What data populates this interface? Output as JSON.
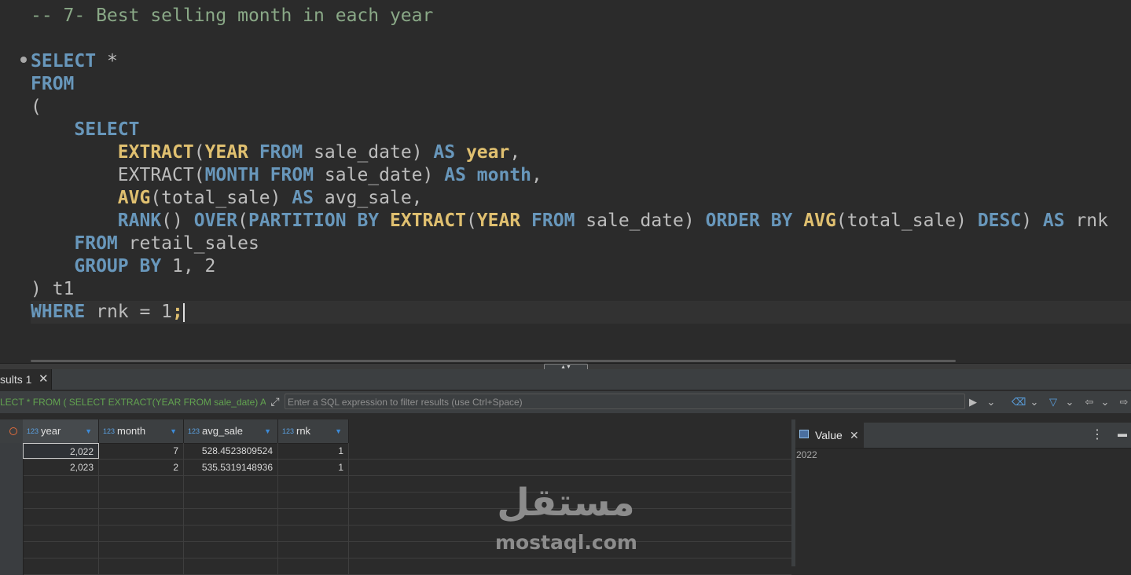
{
  "editor": {
    "lines": [
      [
        {
          "t": "-- 7- Best selling month in each year",
          "c": "cm"
        }
      ],
      [],
      [
        {
          "t": "SELECT",
          "c": "kw"
        },
        {
          "t": " *",
          "c": "plain"
        }
      ],
      [
        {
          "t": "FROM",
          "c": "kw"
        }
      ],
      [
        {
          "t": "(",
          "c": "plain"
        }
      ],
      [
        {
          "t": "    ",
          "c": "plain"
        },
        {
          "t": "SELECT",
          "c": "kw"
        }
      ],
      [
        {
          "t": "        ",
          "c": "plain"
        },
        {
          "t": "EXTRACT",
          "c": "fn"
        },
        {
          "t": "(",
          "c": "plain"
        },
        {
          "t": "YEAR",
          "c": "fn"
        },
        {
          "t": " ",
          "c": "plain"
        },
        {
          "t": "FROM",
          "c": "kw"
        },
        {
          "t": " sale_date) ",
          "c": "plain"
        },
        {
          "t": "AS",
          "c": "kw"
        },
        {
          "t": " ",
          "c": "plain"
        },
        {
          "t": "year",
          "c": "al"
        },
        {
          "t": ",",
          "c": "plain"
        }
      ],
      [
        {
          "t": "        EXTRACT(",
          "c": "plain"
        },
        {
          "t": "MONTH",
          "c": "kw"
        },
        {
          "t": " ",
          "c": "plain"
        },
        {
          "t": "FROM",
          "c": "kw"
        },
        {
          "t": " sale_date) ",
          "c": "plain"
        },
        {
          "t": "AS",
          "c": "kw"
        },
        {
          "t": " ",
          "c": "plain"
        },
        {
          "t": "month",
          "c": "kw"
        },
        {
          "t": ",",
          "c": "plain"
        }
      ],
      [
        {
          "t": "        ",
          "c": "plain"
        },
        {
          "t": "AVG",
          "c": "fn"
        },
        {
          "t": "(total_sale) ",
          "c": "plain"
        },
        {
          "t": "AS",
          "c": "kw"
        },
        {
          "t": " avg_sale,",
          "c": "plain"
        }
      ],
      [
        {
          "t": "        ",
          "c": "plain"
        },
        {
          "t": "RANK",
          "c": "kw"
        },
        {
          "t": "() ",
          "c": "plain"
        },
        {
          "t": "OVER",
          "c": "kw"
        },
        {
          "t": "(",
          "c": "plain"
        },
        {
          "t": "PARTITION BY",
          "c": "kw"
        },
        {
          "t": " ",
          "c": "plain"
        },
        {
          "t": "EXTRACT",
          "c": "fn"
        },
        {
          "t": "(",
          "c": "plain"
        },
        {
          "t": "YEAR",
          "c": "fn"
        },
        {
          "t": " ",
          "c": "plain"
        },
        {
          "t": "FROM",
          "c": "kw"
        },
        {
          "t": " sale_date) ",
          "c": "plain"
        },
        {
          "t": "ORDER BY",
          "c": "kw"
        },
        {
          "t": " ",
          "c": "plain"
        },
        {
          "t": "AVG",
          "c": "fn"
        },
        {
          "t": "(total_sale) ",
          "c": "plain"
        },
        {
          "t": "DESC",
          "c": "kw"
        },
        {
          "t": ") ",
          "c": "plain"
        },
        {
          "t": "AS",
          "c": "kw"
        },
        {
          "t": " rnk",
          "c": "plain"
        }
      ],
      [
        {
          "t": "    ",
          "c": "plain"
        },
        {
          "t": "FROM",
          "c": "kw"
        },
        {
          "t": " retail_sales",
          "c": "plain"
        }
      ],
      [
        {
          "t": "    ",
          "c": "plain"
        },
        {
          "t": "GROUP BY",
          "c": "kw"
        },
        {
          "t": " 1, 2",
          "c": "plain"
        }
      ],
      [
        {
          "t": ") t1",
          "c": "plain"
        }
      ],
      [
        {
          "t": "WHERE",
          "c": "kw"
        },
        {
          "t": " rnk = 1",
          "c": "plain"
        },
        {
          "t": ";",
          "c": "fn"
        }
      ]
    ]
  },
  "results_tab": {
    "label": "sults 1",
    "close": "✕"
  },
  "filter": {
    "query_text": "LECT * FROM ( SELECT EXTRACT(YEAR FROM sale_date) AS y(",
    "placeholder": "Enter a SQL expression to filter results (use Ctrl+Space)"
  },
  "grid": {
    "type_badge": "123",
    "columns": [
      "year",
      "month",
      "avg_sale",
      "rnk"
    ],
    "rows": [
      [
        "2,022",
        "7",
        "528.4523809524",
        "1"
      ],
      [
        "2,023",
        "2",
        "535.5319148936",
        "1"
      ]
    ]
  },
  "value_panel": {
    "title": "Value",
    "close": "✕",
    "value": "2022"
  },
  "watermark": {
    "arabic": "مستقل",
    "latin": "mostaql.com"
  }
}
